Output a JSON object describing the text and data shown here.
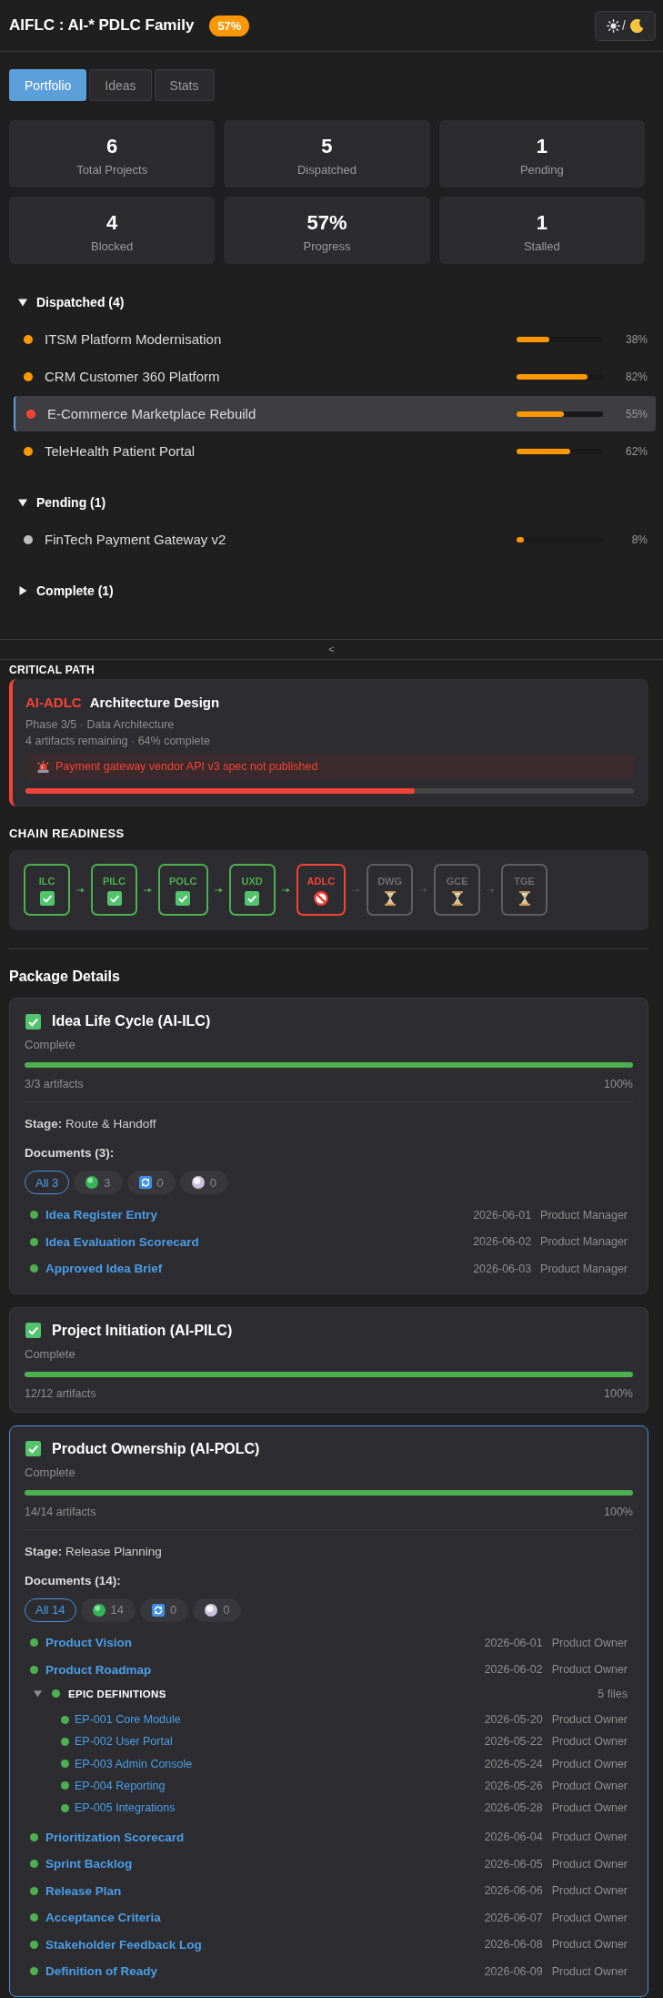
{
  "header": {
    "title": "AIFLC : AI-* PDLC Family",
    "badge": "57%",
    "theme_toggle": {
      "separator": "/"
    }
  },
  "tabs": [
    {
      "label": "Portfolio",
      "selected": true
    },
    {
      "label": "Ideas",
      "selected": false
    },
    {
      "label": "Stats",
      "selected": false
    }
  ],
  "stats": [
    {
      "value": "6",
      "label": "Total Projects"
    },
    {
      "value": "5",
      "label": "Dispatched"
    },
    {
      "value": "1",
      "label": "Pending"
    },
    {
      "value": "4",
      "label": "Blocked"
    },
    {
      "value": "57%",
      "label": "Progress"
    },
    {
      "value": "1",
      "label": "Stalled"
    }
  ],
  "portfolio": {
    "groups": [
      {
        "label": "Dispatched (4)",
        "expanded": true,
        "projects": [
          {
            "name": "ITSM Platform Modernisation",
            "color": "#ff9800",
            "level": 0.38,
            "percent": "38%",
            "selected": false
          },
          {
            "name": "CRM Customer 360 Platform",
            "color": "#ff9800",
            "level": 0.82,
            "percent": "82%",
            "selected": false
          },
          {
            "name": "E-Commerce Marketplace Rebuild",
            "color": "#f44336",
            "level": 0.55,
            "percent": "55%",
            "selected": true
          },
          {
            "name": "TeleHealth Patient Portal",
            "color": "#ff9800",
            "level": 0.62,
            "percent": "62%",
            "selected": false
          }
        ]
      },
      {
        "label": "Pending (1)",
        "expanded": true,
        "projects": [
          {
            "name": "FinTech Payment Gateway v2",
            "color": "#bdbdbd",
            "level": 0.08,
            "percent": "8%",
            "selected": false
          }
        ]
      },
      {
        "label": "Complete (1)",
        "expanded": false
      }
    ]
  },
  "splitter": {
    "label": "<"
  },
  "critical_path": {
    "heading": "CRITICAL PATH",
    "code": "AI-ADLC",
    "title": "Architecture Design",
    "phase": "Phase 3/5 · Data Architecture",
    "summary": "4 artifacts remaining · 64% complete",
    "alert": "Payment gateway vendor API v3 spec not published",
    "level": 0.64
  },
  "chain_readiness": {
    "heading": "CHAIN READINESS",
    "nodes": [
      {
        "label": "ILC",
        "kind": "done"
      },
      {
        "label": "PILC",
        "kind": "done"
      },
      {
        "label": "POLC",
        "kind": "done"
      },
      {
        "label": "UXD",
        "kind": "done"
      },
      {
        "label": "ADLC",
        "kind": "blocked"
      },
      {
        "label": "DWG",
        "kind": "waiting"
      },
      {
        "label": "GCE",
        "kind": "waiting"
      },
      {
        "label": "TGE",
        "kind": "waiting"
      }
    ]
  },
  "package_details": {
    "heading": "Package Details",
    "packages": [
      {
        "title": "Idea Life Cycle (AI-ILC)",
        "complete": true,
        "status_text": "Complete",
        "level": 1,
        "artifacts": "3/3 artifacts",
        "percent": "100%",
        "selected": false,
        "stage": "**Stage:** Route & Handoff",
        "documents_heading": "Documents (3):",
        "filters": [
          {
            "kind": "all",
            "label": "All 3",
            "selected": true
          },
          {
            "kind": "done",
            "label": "3",
            "selected": false
          },
          {
            "kind": "in_progress",
            "label": "0",
            "selected": false
          },
          {
            "kind": "pending",
            "label": "0",
            "selected": false
          }
        ],
        "documents": [
          {
            "kind": "file",
            "name": "Idea Register Entry",
            "complete": true,
            "date": "2026-06-01",
            "owner": "Product Manager"
          },
          {
            "kind": "file",
            "name": "Idea Evaluation Scorecard",
            "complete": true,
            "date": "2026-06-02",
            "owner": "Product Manager"
          },
          {
            "kind": "file",
            "name": "Approved Idea Brief",
            "complete": true,
            "date": "2026-06-03",
            "owner": "Product Manager"
          }
        ]
      },
      {
        "title": "Project Initiation (AI-PILC)",
        "complete": true,
        "status_text": "Complete",
        "level": 1,
        "artifacts": "12/12 artifacts",
        "percent": "100%",
        "selected": false
      },
      {
        "title": "Product Ownership (AI-POLC)",
        "complete": true,
        "status_text": "Complete",
        "level": 1,
        "artifacts": "14/14 artifacts",
        "percent": "100%",
        "selected": true,
        "stage": "**Stage:** Release Planning",
        "documents_heading": "Documents (14):",
        "filters": [
          {
            "kind": "all",
            "label": "All 14",
            "selected": true
          },
          {
            "kind": "done",
            "label": "14",
            "selected": false
          },
          {
            "kind": "in_progress",
            "label": "0",
            "selected": false
          },
          {
            "kind": "pending",
            "label": "0",
            "selected": false
          }
        ],
        "documents": [
          {
            "kind": "file",
            "name": "Product Vision",
            "complete": true,
            "date": "2026-06-01",
            "owner": "Product Owner"
          },
          {
            "kind": "file",
            "name": "Product Roadmap",
            "complete": true,
            "date": "2026-06-02",
            "owner": "Product Owner"
          },
          {
            "kind": "group",
            "name": "EPIC DEFINITIONS",
            "complete": true,
            "count": "5 files",
            "expanded": true,
            "children": [
              {
                "name": "EP-001 Core Module",
                "complete": true,
                "date": "2026-05-20",
                "owner": "Product Owner"
              },
              {
                "name": "EP-002 User Portal",
                "complete": true,
                "date": "2026-05-22",
                "owner": "Product Owner"
              },
              {
                "name": "EP-003 Admin Console",
                "complete": true,
                "date": "2026-05-24",
                "owner": "Product Owner"
              },
              {
                "name": "EP-004 Reporting",
                "complete": true,
                "date": "2026-05-26",
                "owner": "Product Owner"
              },
              {
                "name": "EP-005 Integrations",
                "complete": true,
                "date": "2026-05-28",
                "owner": "Product Owner"
              }
            ]
          },
          {
            "kind": "file",
            "name": "Prioritization Scorecard",
            "complete": true,
            "date": "2026-06-04",
            "owner": "Product Owner"
          },
          {
            "kind": "file",
            "name": "Sprint Backlog",
            "complete": true,
            "date": "2026-06-05",
            "owner": "Product Owner"
          },
          {
            "kind": "file",
            "name": "Release Plan",
            "complete": true,
            "date": "2026-06-06",
            "owner": "Product Owner"
          },
          {
            "kind": "file",
            "name": "Acceptance Criteria",
            "complete": true,
            "date": "2026-06-07",
            "owner": "Product Owner"
          },
          {
            "kind": "file",
            "name": "Stakeholder Feedback Log",
            "complete": true,
            "date": "2026-06-08",
            "owner": "Product Owner"
          },
          {
            "kind": "file",
            "name": "Definition of Ready",
            "complete": true,
            "date": "2026-06-09",
            "owner": "Product Owner"
          }
        ]
      }
    ]
  }
}
